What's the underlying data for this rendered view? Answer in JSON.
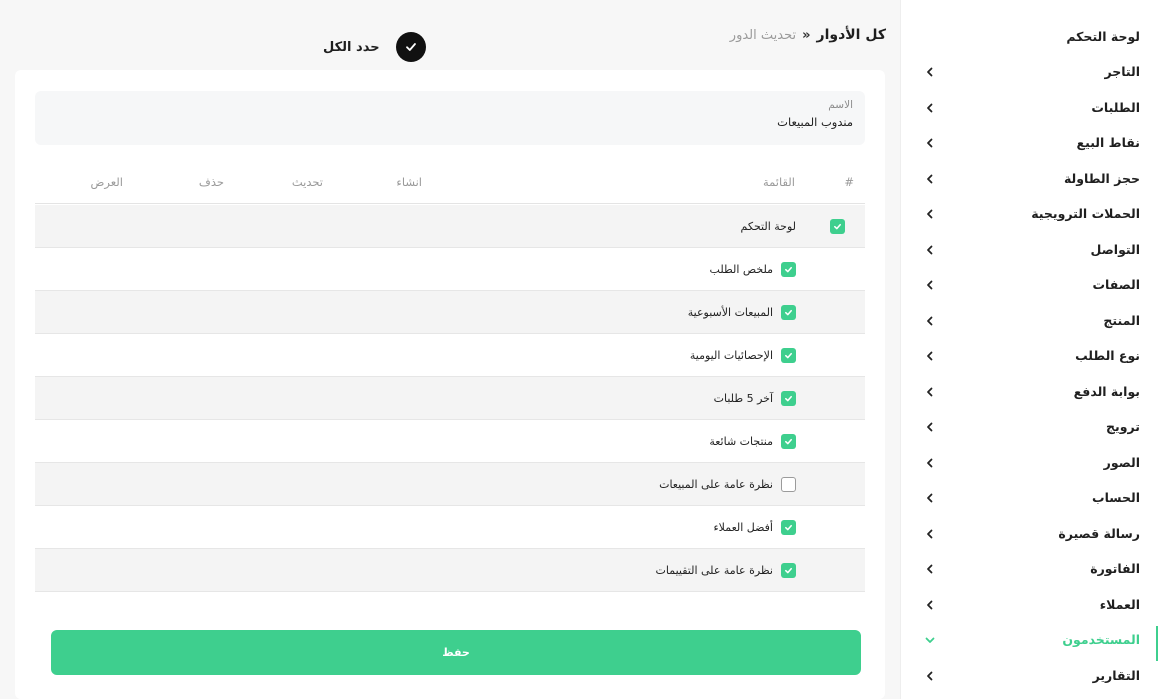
{
  "colors": {
    "accent": "#3ecf8e",
    "sidebar_bg": "#ffffff",
    "page_bg": "#f7f7f7",
    "dark": "#111111"
  },
  "sidebar": {
    "items": [
      {
        "label": "لوحة التحكم",
        "chevron": "none",
        "active": false
      },
      {
        "label": "التاجر",
        "chevron": "chevron-left-icon",
        "active": false
      },
      {
        "label": "الطلبات",
        "chevron": "chevron-left-icon",
        "active": false
      },
      {
        "label": "نقاط البيع",
        "chevron": "chevron-left-icon",
        "active": false
      },
      {
        "label": "حجز الطاولة",
        "chevron": "chevron-left-icon",
        "active": false
      },
      {
        "label": "الحملات الترويجية",
        "chevron": "chevron-left-icon",
        "active": false
      },
      {
        "label": "التواصل",
        "chevron": "chevron-left-icon",
        "active": false
      },
      {
        "label": "الصفات",
        "chevron": "chevron-left-icon",
        "active": false
      },
      {
        "label": "المنتج",
        "chevron": "chevron-left-icon",
        "active": false
      },
      {
        "label": "نوع الطلب",
        "chevron": "chevron-left-icon",
        "active": false
      },
      {
        "label": "بوابة الدفع",
        "chevron": "chevron-left-icon",
        "active": false
      },
      {
        "label": "ترويج",
        "chevron": "chevron-left-icon",
        "active": false
      },
      {
        "label": "الصور",
        "chevron": "chevron-left-icon",
        "active": false
      },
      {
        "label": "الحساب",
        "chevron": "chevron-left-icon",
        "active": false
      },
      {
        "label": "رسالة قصيرة",
        "chevron": "chevron-left-icon",
        "active": false
      },
      {
        "label": "الفاتورة",
        "chevron": "chevron-left-icon",
        "active": false
      },
      {
        "label": "العملاء",
        "chevron": "chevron-left-icon",
        "active": false
      },
      {
        "label": "المستخدمون",
        "chevron": "chevron-down-icon",
        "active": true
      },
      {
        "label": "التقارير",
        "chevron": "chevron-left-icon",
        "active": false
      }
    ]
  },
  "header": {
    "breadcrumb_main": "كل الأدوار",
    "breadcrumb_sep": "»",
    "breadcrumb_sub": "تحديث الدور",
    "select_all_label": "حدد الكل",
    "select_all_icon": "check-icon"
  },
  "form": {
    "name_label": "الاسم",
    "name_value": "مندوب المبيعات"
  },
  "table": {
    "columns": [
      "#",
      "القائمة",
      "انشاء",
      "تحديث",
      "حذف",
      "العرض"
    ],
    "rows": [
      {
        "label": "لوحة التحكم",
        "checked": true,
        "level": 0
      },
      {
        "label": "ملخص الطلب",
        "checked": true,
        "level": 1
      },
      {
        "label": "المبيعات الأسبوعية",
        "checked": true,
        "level": 1
      },
      {
        "label": "الإحصائيات اليومية",
        "checked": true,
        "level": 1
      },
      {
        "label": "آخر 5 طلبات",
        "checked": true,
        "level": 1
      },
      {
        "label": "منتجات شائعة",
        "checked": true,
        "level": 1
      },
      {
        "label": "نظرة عامة على المبيعات",
        "checked": false,
        "level": 1
      },
      {
        "label": "أفضل العملاء",
        "checked": true,
        "level": 1
      },
      {
        "label": "نظرة عامة على التقييمات",
        "checked": true,
        "level": 1
      }
    ]
  },
  "actions": {
    "save_label": "حفظ"
  }
}
